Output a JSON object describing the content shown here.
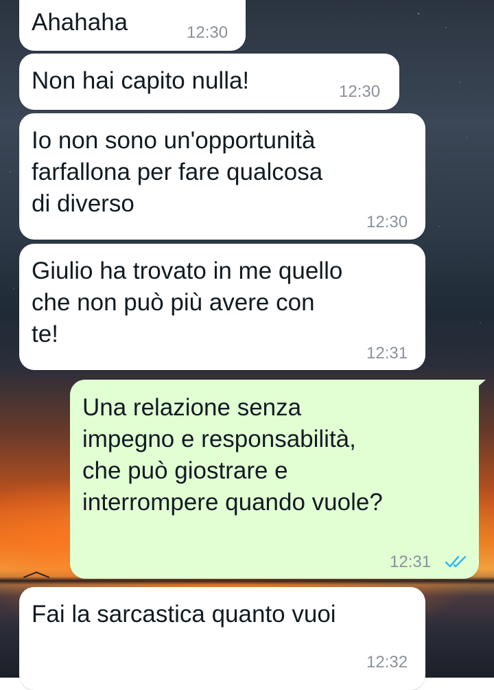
{
  "chat": {
    "messages": [
      {
        "direction": "incoming",
        "text": "Ahahaha",
        "time": "12:30"
      },
      {
        "direction": "incoming",
        "text": "Non hai capito nulla!",
        "time": "12:30"
      },
      {
        "direction": "incoming",
        "text": "Io non sono un'opportunità\nfarfallona per fare qualcosa\ndi diverso",
        "time": "12:30"
      },
      {
        "direction": "incoming",
        "text": "Giulio ha trovato in me quello\nche non può più avere con\nte!",
        "time": "12:31"
      },
      {
        "direction": "outgoing",
        "text": "Una relazione senza\nimpegno e responsabilità,\nche può giostrare e\ninterrompere quando vuole?",
        "time": "12:31",
        "status": "read"
      },
      {
        "direction": "incoming",
        "text": "Fai la sarcastica quanto vuoi",
        "time": "12:32"
      }
    ]
  },
  "theme": {
    "incoming_bubble": "#ffffff",
    "outgoing_bubble": "#e2ffd4",
    "read_tick_color": "#34b7f1",
    "time_color": "#8a9198"
  },
  "icons": {
    "read_receipt": "double-check-icon"
  }
}
